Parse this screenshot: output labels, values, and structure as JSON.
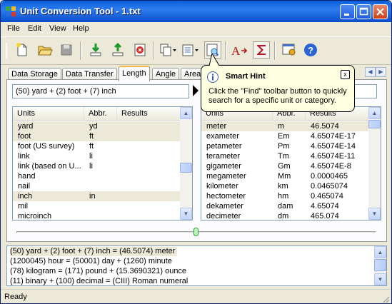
{
  "window": {
    "title": "Unit Conversion Tool - 1.txt"
  },
  "menu": [
    "File",
    "Edit",
    "View",
    "Help"
  ],
  "toolbar": {
    "icons": [
      "new-file-icon",
      "open-folder-icon",
      "save-icon",
      "import-icon",
      "export-icon",
      "delete-icon",
      "copy-dropdown-icon",
      "paste-dropdown-icon",
      "find-icon",
      "text-format-icon",
      "sum-icon",
      "options-icon",
      "help-icon"
    ]
  },
  "tabs": [
    "Data Storage",
    "Data Transfer",
    "Length",
    "Angle",
    "Area"
  ],
  "active_tab": "Length",
  "expression": {
    "value": "(50) yard + (2) foot + (7) inch"
  },
  "left_list": {
    "columns": [
      "Units",
      "Abbr.",
      "Results"
    ],
    "rows": [
      {
        "unit": "yard",
        "abbr": "yd",
        "result": "",
        "selected": true
      },
      {
        "unit": "foot",
        "abbr": "ft",
        "result": "",
        "selected": true
      },
      {
        "unit": "foot (US survey)",
        "abbr": "ft",
        "result": "",
        "selected": false
      },
      {
        "unit": "link",
        "abbr": "li",
        "result": "",
        "selected": false
      },
      {
        "unit": "link (based on U...",
        "abbr": "li",
        "result": "",
        "selected": false
      },
      {
        "unit": "hand",
        "abbr": "",
        "result": "",
        "selected": false
      },
      {
        "unit": "nail",
        "abbr": "",
        "result": "",
        "selected": false
      },
      {
        "unit": "inch",
        "abbr": "in",
        "result": "",
        "selected": true
      },
      {
        "unit": "mil",
        "abbr": "",
        "result": "",
        "selected": false
      },
      {
        "unit": "microinch",
        "abbr": "",
        "result": "",
        "selected": false
      }
    ]
  },
  "right_list": {
    "columns": [
      "Units",
      "Abbr.",
      "Results"
    ],
    "rows": [
      {
        "unit": "meter",
        "abbr": "m",
        "result": "46.5074",
        "selected": true
      },
      {
        "unit": "exameter",
        "abbr": "Em",
        "result": "4.65074E-17",
        "selected": false
      },
      {
        "unit": "petameter",
        "abbr": "Pm",
        "result": "4.65074E-14",
        "selected": false
      },
      {
        "unit": "terameter",
        "abbr": "Tm",
        "result": "4.65074E-11",
        "selected": false
      },
      {
        "unit": "gigameter",
        "abbr": "Gm",
        "result": "4.65074E-8",
        "selected": false
      },
      {
        "unit": "megameter",
        "abbr": "Mm",
        "result": "0.0000465",
        "selected": false
      },
      {
        "unit": "kilometer",
        "abbr": "km",
        "result": "0.0465074",
        "selected": false
      },
      {
        "unit": "hectometer",
        "abbr": "hm",
        "result": "0.465074",
        "selected": false
      },
      {
        "unit": "dekameter",
        "abbr": "dam",
        "result": "4.65074",
        "selected": false
      },
      {
        "unit": "decimeter",
        "abbr": "dm",
        "result": "465.074",
        "selected": false
      }
    ]
  },
  "log": [
    "(50) yard + (2) foot + (7) inch = (46.5074) meter",
    "(1200045) hour = (50001) day + (1260) minute",
    "(78) kilogram = (171) pound + (15.3690321) ounce",
    "(11) binary + (100) decimal = (CIII) Roman numeral"
  ],
  "status": "Ready",
  "hint": {
    "title": "Smart Hint",
    "body": "Click the \"Find\" toolbar button to quickly search for a specific unit or category.",
    "close": "x"
  },
  "colors": {
    "title_bar": "#0a5fd8",
    "selection": "#ece9d8",
    "balloon": "#ffffe1",
    "active_tab_accent": "#f4b24a"
  }
}
